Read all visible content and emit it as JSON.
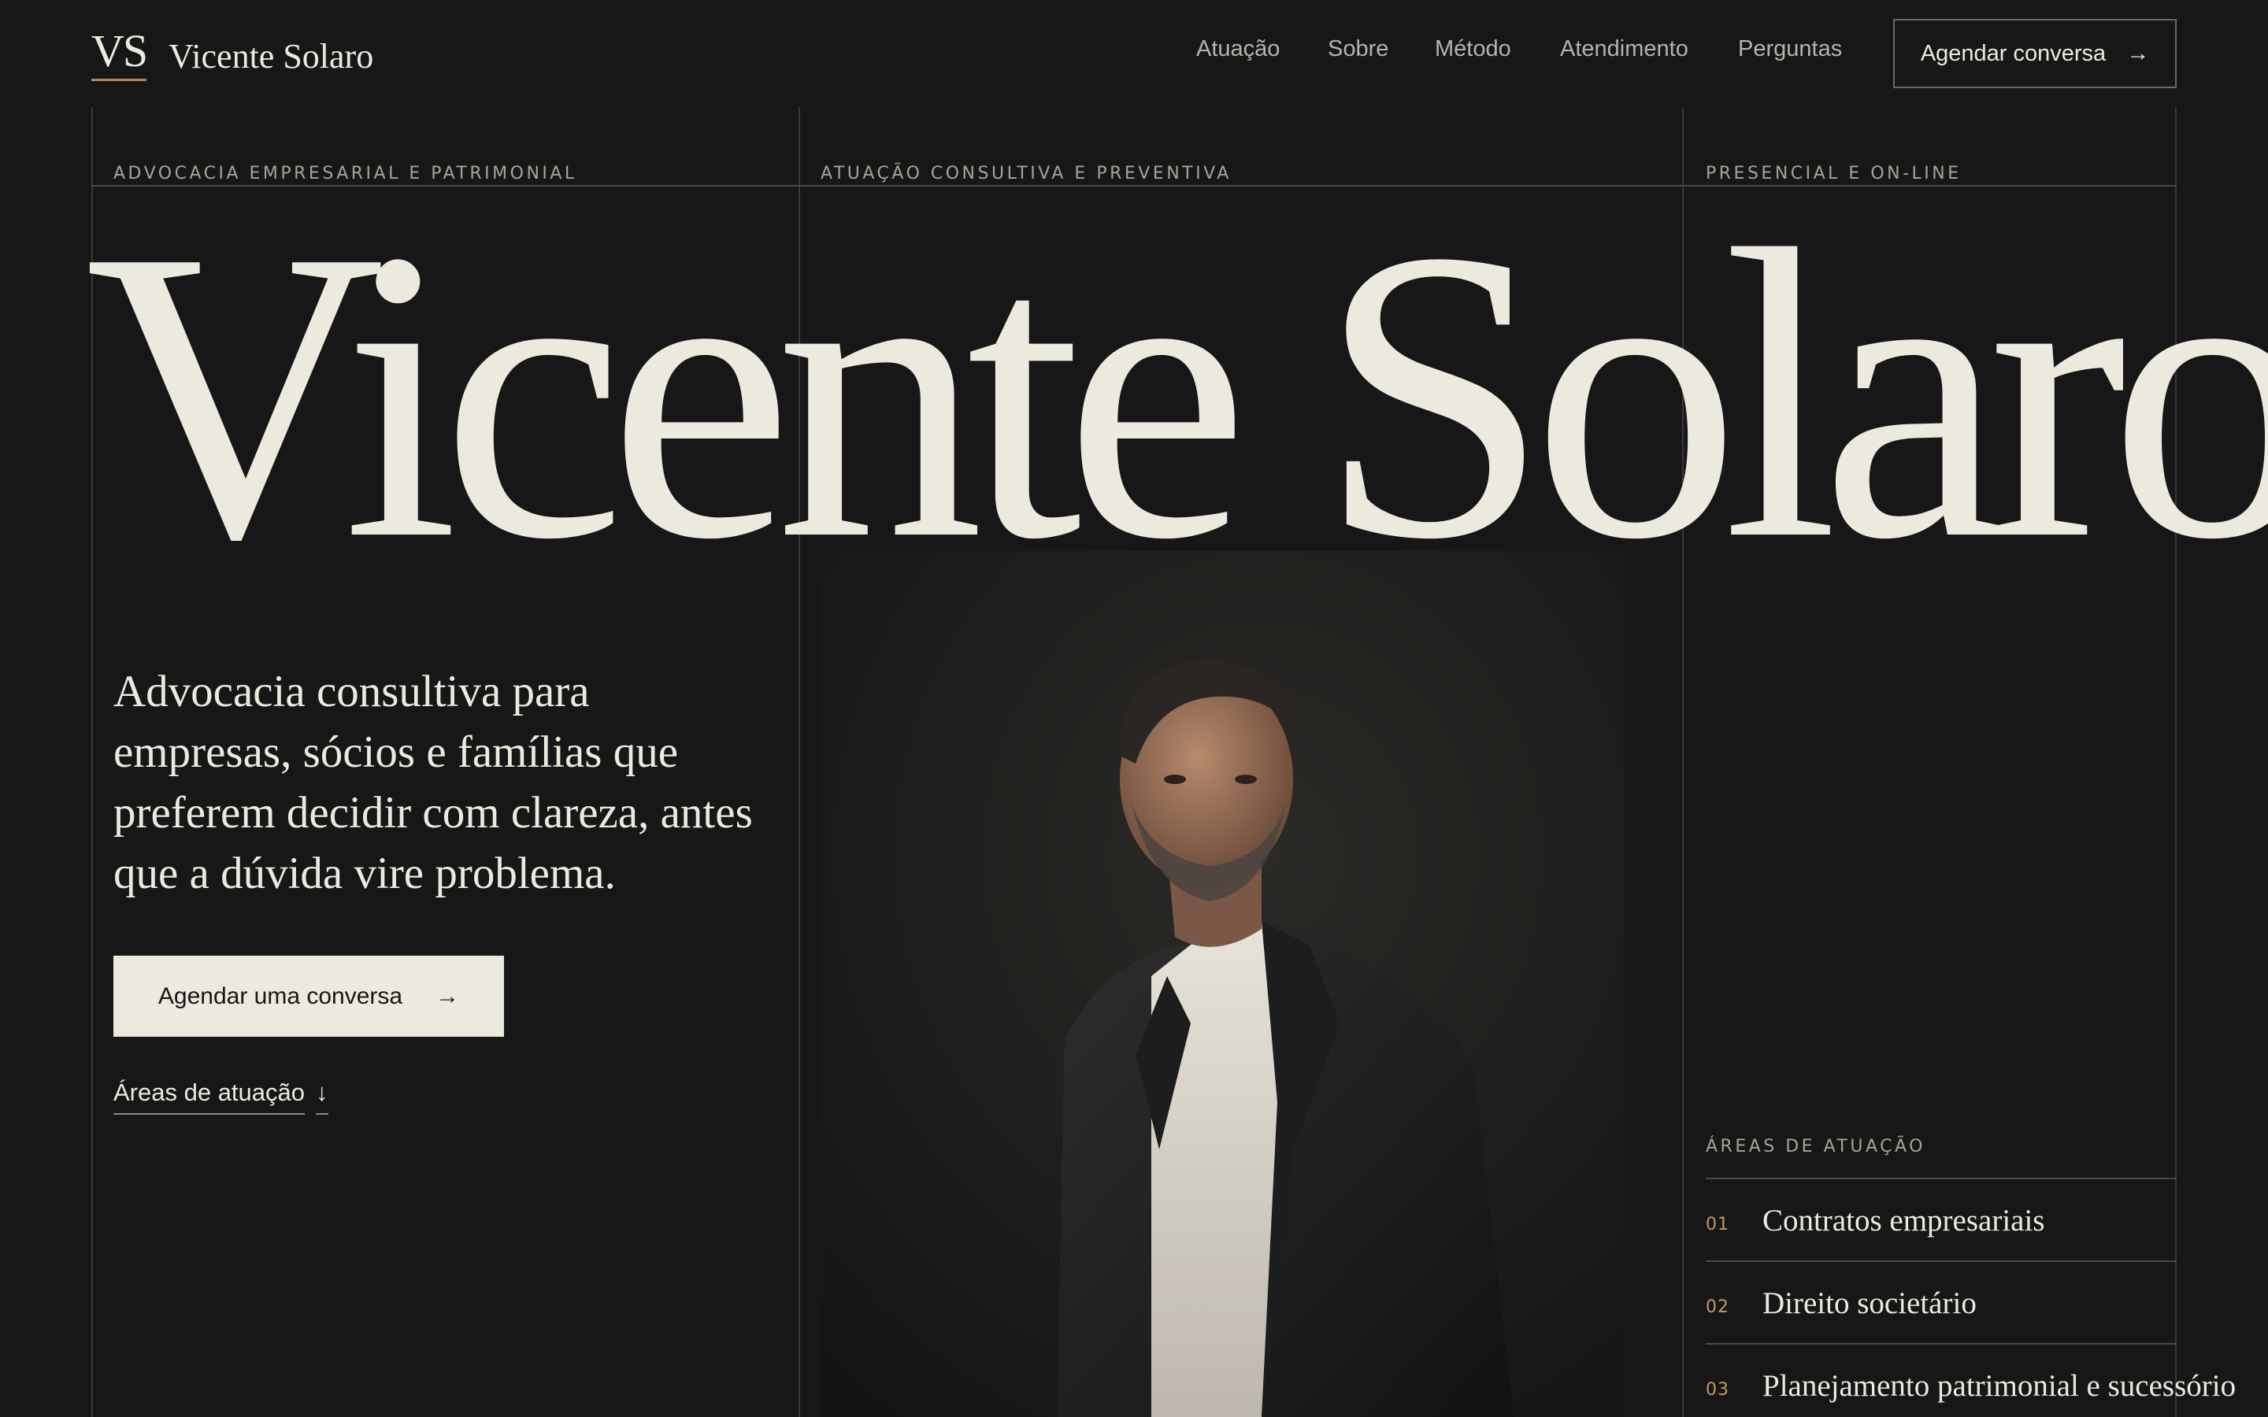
{
  "header": {
    "logo_mark": "VS",
    "logo_name": "Vicente Solaro",
    "nav": [
      "Atuação",
      "Sobre",
      "Método",
      "Atendimento",
      "Perguntas"
    ],
    "cta_label": "Agendar conversa",
    "cta_arrow": "→"
  },
  "eyebrows": [
    "ADVOCACIA EMPRESARIAL E PATRIMONIAL",
    "ATUAÇÃO CONSULTIVA E PREVENTIVA",
    "PRESENCIAL E ON-LINE"
  ],
  "hero": {
    "title": "Vicente Solaro",
    "lede": "Advocacia consultiva para empresas, sócios e famílias que preferem decidir com clareza, antes que a dúvida vire problema.",
    "primary_cta": "Agendar uma conversa",
    "primary_cta_arrow": "→",
    "secondary_link": "Áreas de atuação",
    "secondary_link_arrow": "↓"
  },
  "areas": {
    "label": "ÁREAS DE ATUAÇÃO",
    "items": [
      {
        "num": "01",
        "name": "Contratos empresariais"
      },
      {
        "num": "02",
        "name": "Direito societário"
      },
      {
        "num": "03",
        "name": "Planejamento patrimonial e sucessório"
      }
    ]
  },
  "colors": {
    "background": "#171717",
    "text": "#ece9df",
    "accent": "#c19a63",
    "muted": "#a7a398"
  }
}
